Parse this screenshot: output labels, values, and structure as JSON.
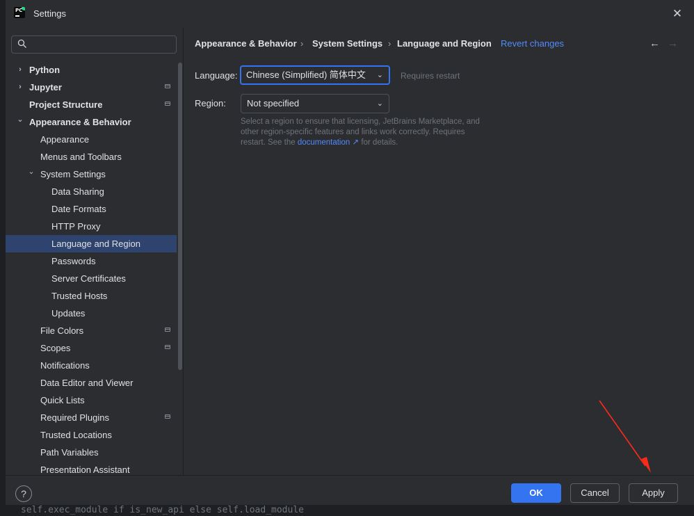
{
  "window": {
    "title": "Settings",
    "close_icon": "✕"
  },
  "search": {
    "placeholder": "",
    "value": ""
  },
  "sidebar": {
    "items": [
      {
        "label": "Python",
        "bold": true,
        "chevron": "›",
        "level": 0,
        "project": false
      },
      {
        "label": "Jupyter",
        "bold": true,
        "chevron": "›",
        "level": 0,
        "project": true
      },
      {
        "label": "Project Structure",
        "bold": true,
        "chevron": "",
        "level": 0,
        "project": true
      },
      {
        "label": "Appearance & Behavior",
        "bold": true,
        "chevron": "⌄",
        "level": 0,
        "project": false
      },
      {
        "label": "Appearance",
        "bold": false,
        "chevron": "",
        "level": 1,
        "project": false
      },
      {
        "label": "Menus and Toolbars",
        "bold": false,
        "chevron": "",
        "level": 1,
        "project": false
      },
      {
        "label": "System Settings",
        "bold": false,
        "chevron": "⌄",
        "level": 1,
        "project": false
      },
      {
        "label": "Data Sharing",
        "bold": false,
        "chevron": "",
        "level": 2,
        "project": false
      },
      {
        "label": "Date Formats",
        "bold": false,
        "chevron": "",
        "level": 2,
        "project": false
      },
      {
        "label": "HTTP Proxy",
        "bold": false,
        "chevron": "",
        "level": 2,
        "project": false
      },
      {
        "label": "Language and Region",
        "bold": false,
        "chevron": "",
        "level": 2,
        "project": false,
        "selected": true
      },
      {
        "label": "Passwords",
        "bold": false,
        "chevron": "",
        "level": 2,
        "project": false
      },
      {
        "label": "Server Certificates",
        "bold": false,
        "chevron": "",
        "level": 2,
        "project": false
      },
      {
        "label": "Trusted Hosts",
        "bold": false,
        "chevron": "",
        "level": 2,
        "project": false
      },
      {
        "label": "Updates",
        "bold": false,
        "chevron": "",
        "level": 2,
        "project": false
      },
      {
        "label": "File Colors",
        "bold": false,
        "chevron": "",
        "level": 1,
        "project": true
      },
      {
        "label": "Scopes",
        "bold": false,
        "chevron": "",
        "level": 1,
        "project": true
      },
      {
        "label": "Notifications",
        "bold": false,
        "chevron": "",
        "level": 1,
        "project": false
      },
      {
        "label": "Data Editor and Viewer",
        "bold": false,
        "chevron": "",
        "level": 1,
        "project": false
      },
      {
        "label": "Quick Lists",
        "bold": false,
        "chevron": "",
        "level": 1,
        "project": false
      },
      {
        "label": "Required Plugins",
        "bold": false,
        "chevron": "",
        "level": 1,
        "project": true
      },
      {
        "label": "Trusted Locations",
        "bold": false,
        "chevron": "",
        "level": 1,
        "project": false
      },
      {
        "label": "Path Variables",
        "bold": false,
        "chevron": "",
        "level": 1,
        "project": false
      },
      {
        "label": "Presentation Assistant",
        "bold": false,
        "chevron": "",
        "level": 1,
        "project": false
      }
    ]
  },
  "breadcrumb": {
    "items": [
      "Appearance & Behavior",
      "System Settings",
      "Language and Region"
    ],
    "separator": "›",
    "revert_label": "Revert changes"
  },
  "nav": {
    "back_icon": "←",
    "forward_icon": "→"
  },
  "form": {
    "language_label": "Language:",
    "language_value": "Chinese (Simplified) 简体中文",
    "language_hint": "Requires restart",
    "region_label": "Region:",
    "region_value": "Not specified",
    "desc_line1": "Select a region to ensure that licensing, JetBrains Marketplace, and",
    "desc_line2": "other region-specific features and links work correctly. Requires",
    "desc_line3_prefix": "restart. See the ",
    "desc_link": "documentation",
    "desc_link_icon": "↗",
    "desc_line3_suffix": " for details."
  },
  "footer": {
    "help_label": "?",
    "ok_label": "OK",
    "cancel_label": "Cancel",
    "apply_label": "Apply"
  },
  "colors": {
    "accent": "#3574f0",
    "link": "#548af7",
    "selection": "#2e436e",
    "annotation_arrow": "#ff2a1a"
  },
  "background_code": "self.exec_module if is_new_api else self.load_module"
}
